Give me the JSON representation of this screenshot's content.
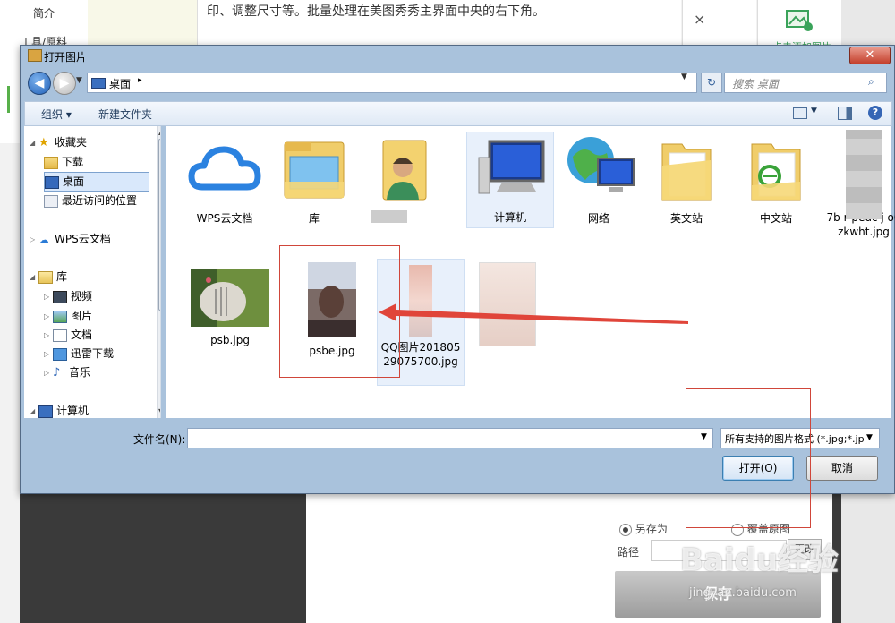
{
  "background": {
    "left_nav": [
      "简介",
      "工具/原料"
    ],
    "article_text": "印、调整尺寸等。批量处理在美图秀秀主界面中央的右下角。",
    "close_label": "×",
    "add_image_label": "点击添加图片",
    "save_option_save_as": "另存为",
    "save_option_overwrite": "覆盖原图",
    "path_label": "路径",
    "change_label": "更改",
    "save_button": "保存",
    "watermark": "Baidu经验",
    "watermark_url": "jingyan.baidu.com"
  },
  "dialog": {
    "title": "打开图片",
    "close": "✕",
    "address": {
      "location": "桌面",
      "arrow": "▸"
    },
    "search_placeholder": "搜索 桌面",
    "toolbar": {
      "organize": "组织 ▾",
      "new_folder": "新建文件夹",
      "help": "?"
    },
    "nav": [
      {
        "label": "收藏夹",
        "icon": "star",
        "level": 0,
        "expanded": true
      },
      {
        "label": "下载",
        "icon": "folder",
        "level": 1
      },
      {
        "label": "桌面",
        "icon": "desk",
        "level": 1,
        "selected": true
      },
      {
        "label": "最近访问的位置",
        "icon": "recent",
        "level": 1
      },
      {
        "label": "WPS云文档",
        "icon": "cloud",
        "level": 0,
        "expanded": false
      },
      {
        "label": "库",
        "icon": "lib",
        "level": 0,
        "expanded": true
      },
      {
        "label": "视频",
        "icon": "video",
        "level": 1,
        "expanded": false
      },
      {
        "label": "图片",
        "icon": "pic",
        "level": 1,
        "expanded": false
      },
      {
        "label": "文档",
        "icon": "doc",
        "level": 1,
        "expanded": false
      },
      {
        "label": "迅雷下载",
        "icon": "dl",
        "level": 1,
        "expanded": false
      },
      {
        "label": "音乐",
        "icon": "music",
        "level": 1,
        "expanded": false
      },
      {
        "label": "计算机",
        "icon": "pc2",
        "level": 0,
        "expanded": true
      }
    ],
    "files": [
      {
        "name": "WPS云文档",
        "icon": "wps-cloud-icon"
      },
      {
        "name": "库",
        "icon": "library-folder-icon"
      },
      {
        "name": "",
        "icon": "user-folder-icon"
      },
      {
        "name": "计算机",
        "icon": "computer-icon",
        "selected": true
      },
      {
        "name": "网络",
        "icon": "network-icon"
      },
      {
        "name": "英文站",
        "icon": "folder-icon"
      },
      {
        "name": "中文站",
        "icon": "ie-folder-icon"
      },
      {
        "name": "7b      r peuc      j     o0 zkwht.jpg",
        "icon": "image-thumb-icon"
      },
      {
        "name": "psb.jpg",
        "icon": "image-thumb-icon"
      },
      {
        "name": "psbe.jpg",
        "icon": "image-thumb-icon"
      },
      {
        "name": "QQ图片20180529075700.jpg",
        "icon": "image-thumb-icon",
        "selected": true
      },
      {
        "name": "",
        "icon": "image-thumb-icon"
      }
    ],
    "filename_label": "文件名(N):",
    "filename_value": "",
    "filetype": "所有支持的图片格式 (*.jpg;*.jp",
    "open_button": "打开(O)",
    "cancel_button": "取消"
  }
}
